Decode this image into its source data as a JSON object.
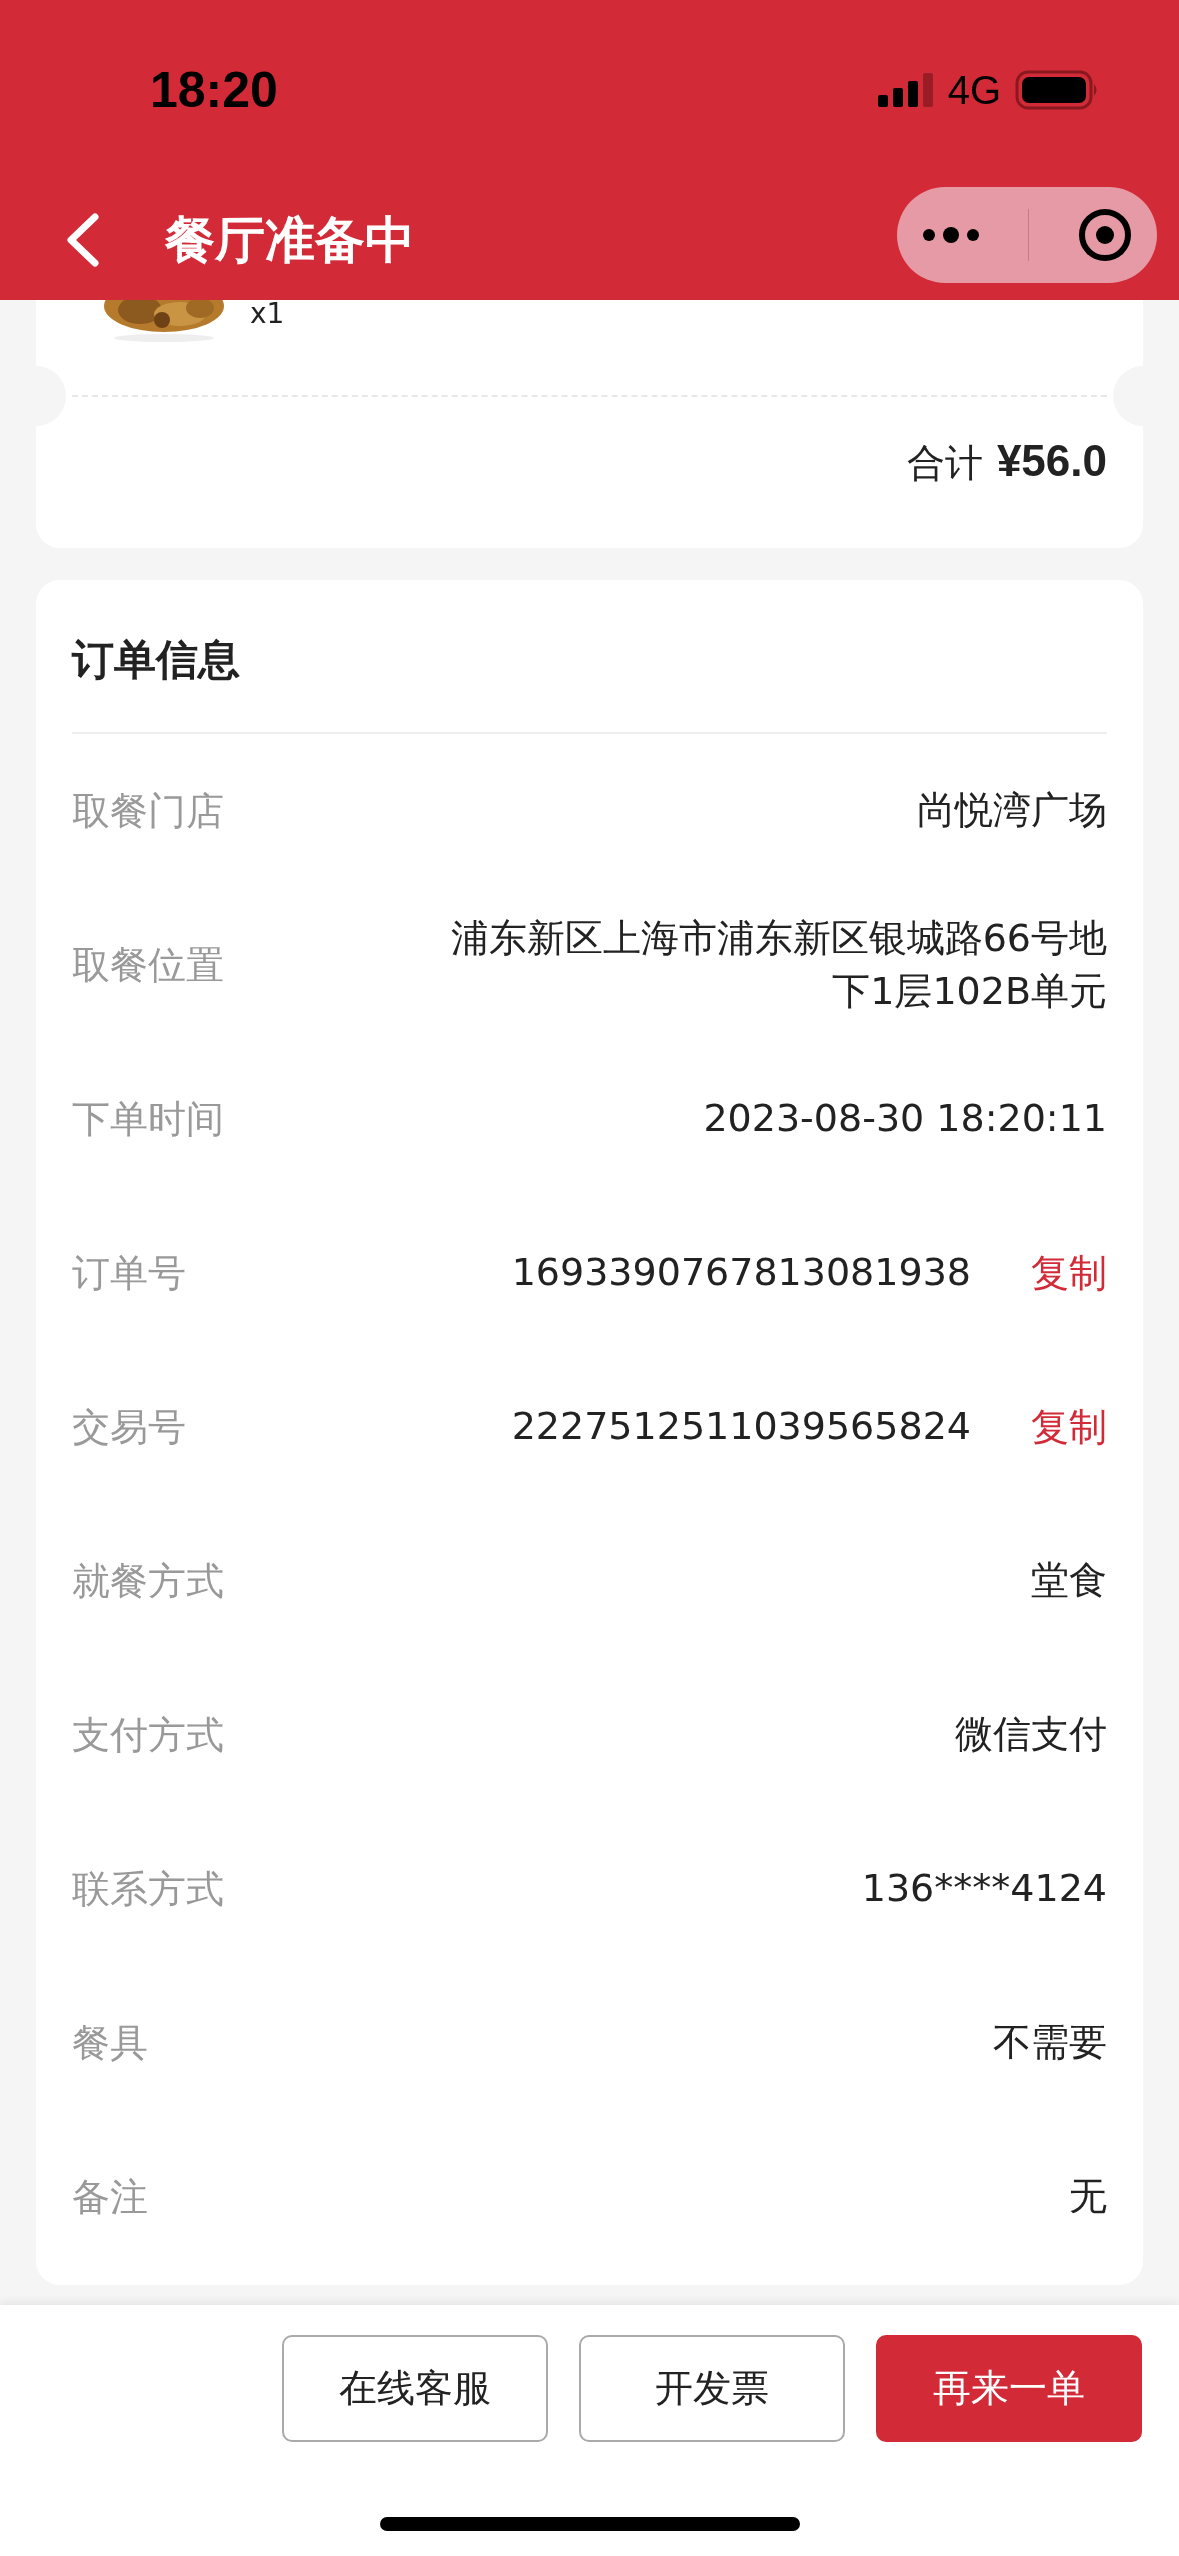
{
  "status_bar": {
    "time": "18:20",
    "network": "4G"
  },
  "nav": {
    "title": "餐厅准备中"
  },
  "order_item": {
    "kind": "picture",
    "quantity": "x1"
  },
  "total": {
    "label": "合计",
    "amount": "¥56.0"
  },
  "order_info": {
    "title": "订单信息",
    "rows": [
      {
        "label": "取餐门店",
        "value": "尚悦湾广场"
      },
      {
        "label": "取餐位置",
        "value": "浦东新区上海市浦东新区银城路66号地下1层102B单元"
      },
      {
        "label": "下单时间",
        "value": "2023-08-30 18:20:11"
      },
      {
        "label": "订单号",
        "value": "1693390767813081938",
        "action": "复制"
      },
      {
        "label": "交易号",
        "value": "2227512511039565824",
        "action": "复制"
      },
      {
        "label": "就餐方式",
        "value": "堂食"
      },
      {
        "label": "支付方式",
        "value": "微信支付"
      },
      {
        "label": "联系方式",
        "value": "136****4124"
      },
      {
        "label": "餐具",
        "value": "不需要"
      },
      {
        "label": "备注",
        "value": "无"
      }
    ]
  },
  "actions": [
    {
      "label": "在线客服",
      "kind": "outline"
    },
    {
      "label": "开发票",
      "kind": "outline"
    },
    {
      "label": "再来一单",
      "kind": "primary"
    }
  ]
}
